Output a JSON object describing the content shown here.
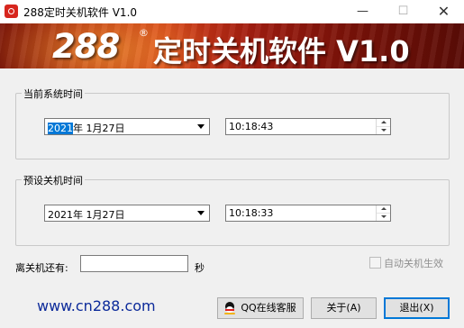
{
  "window": {
    "title": "288定时关机软件 V1.0",
    "minimize_glyph": "—",
    "maximize_glyph": "☐",
    "close_glyph": "✕"
  },
  "banner": {
    "number": "288",
    "registered_mark": "®",
    "title": "定时关机软件 V1.0"
  },
  "current_time_group": {
    "legend": "当前系统时间",
    "date_year": "2021",
    "date_rest": "年  1月27日",
    "time": "10:18:43"
  },
  "shutdown_time_group": {
    "legend": "预设关机时间",
    "date": "2021年  1月27日",
    "time": "10:18:33"
  },
  "countdown": {
    "label": "离关机还有:",
    "value": "",
    "unit": "秒"
  },
  "auto_shutdown": {
    "label": "自动关机生效",
    "checked": false
  },
  "footer": {
    "website": "www.cn288.com",
    "qq_button": "QQ在线客服",
    "about_button": "关于(A)",
    "exit_button": "退出(X)"
  },
  "colors": {
    "selection": "#0078d7",
    "website_text": "#0c2a9a",
    "banner_red": "#b82810"
  },
  "icons": {
    "app": "alarm-clock-icon",
    "qq": "qq-penguin-icon",
    "dropdown": "chevron-down-icon"
  }
}
